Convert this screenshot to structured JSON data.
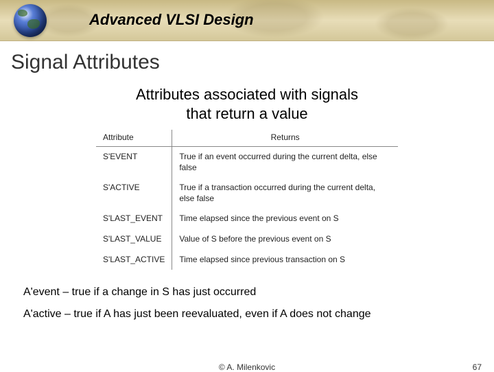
{
  "header": {
    "course": "Advanced VLSI Design"
  },
  "page": {
    "title": "Signal Attributes",
    "subtitle_l1": "Attributes associated with signals",
    "subtitle_l2": "that return a value"
  },
  "table": {
    "head": {
      "c0": "Attribute",
      "c1": "Returns"
    },
    "rows": [
      {
        "attr": "S'EVENT",
        "ret": "True if an event occurred during the current delta, else false"
      },
      {
        "attr": "S'ACTIVE",
        "ret": "True if a transaction occurred during the current delta, else false"
      },
      {
        "attr": "S'LAST_EVENT",
        "ret": "Time elapsed since the previous event on S"
      },
      {
        "attr": "S'LAST_VALUE",
        "ret": "Value of S before the previous event on S"
      },
      {
        "attr": "S'LAST_ACTIVE",
        "ret": "Time elapsed since previous transaction on S"
      }
    ]
  },
  "notes": {
    "n0": "A'event – true if a change in S has just occurred",
    "n1": "A'active – true if A has just been reevaluated, even if A does not change"
  },
  "footer": {
    "author": "© A. Milenkovic",
    "page_no": "67"
  }
}
